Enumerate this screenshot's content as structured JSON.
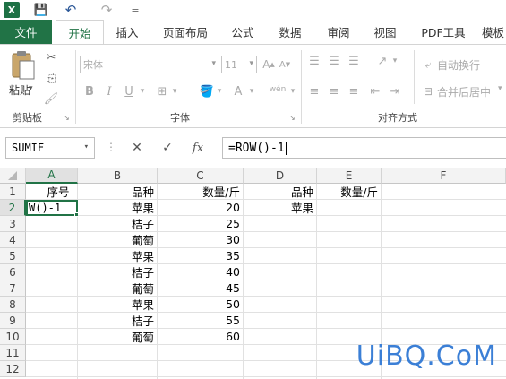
{
  "titlebar": {
    "app_logo": "X",
    "save_icon": "💾",
    "undo_icon": "↶",
    "redo_icon": "↷",
    "customize_icon": "="
  },
  "tabs": [
    {
      "label": "文件"
    },
    {
      "label": "开始"
    },
    {
      "label": "插入"
    },
    {
      "label": "页面布局"
    },
    {
      "label": "公式"
    },
    {
      "label": "数据"
    },
    {
      "label": "审阅"
    },
    {
      "label": "视图"
    },
    {
      "label": "PDF工具"
    },
    {
      "label": "模板"
    }
  ],
  "ribbon": {
    "clipboard": {
      "paste_label": "粘贴",
      "group_label": "剪贴板"
    },
    "font": {
      "font_name": "宋体",
      "font_size": "11",
      "group_label": "字体",
      "bold": "B",
      "italic": "I",
      "underline": "U",
      "font_color": "A",
      "phonetic": "wén"
    },
    "alignment": {
      "wrap_text": "自动换行",
      "merge_center": "合并后居中",
      "group_label": "对齐方式"
    }
  },
  "formula_bar": {
    "name_box": "SUMIF",
    "cancel": "✕",
    "enter": "✓",
    "fx": "fx",
    "formula": "=ROW()-1"
  },
  "columns": [
    "A",
    "B",
    "C",
    "D",
    "E",
    "F"
  ],
  "rows": [
    "1",
    "2",
    "3",
    "4",
    "5",
    "6",
    "7",
    "8",
    "9",
    "10",
    "11",
    "12"
  ],
  "cells": {
    "A1": "序号",
    "B1": "品种",
    "C1": "数量/斤",
    "D1": "品种",
    "E1": "数量/斤",
    "A2": "W()-1",
    "B2": "苹果",
    "C2": "20",
    "D2": "苹果",
    "B3": "桔子",
    "C3": "25",
    "B4": "葡萄",
    "C4": "30",
    "B5": "苹果",
    "C5": "35",
    "B6": "桔子",
    "C6": "40",
    "B7": "葡萄",
    "C7": "45",
    "B8": "苹果",
    "C8": "50",
    "B9": "桔子",
    "C9": "55",
    "B10": "葡萄",
    "C10": "60"
  },
  "watermark": "UiBQ.CoM"
}
